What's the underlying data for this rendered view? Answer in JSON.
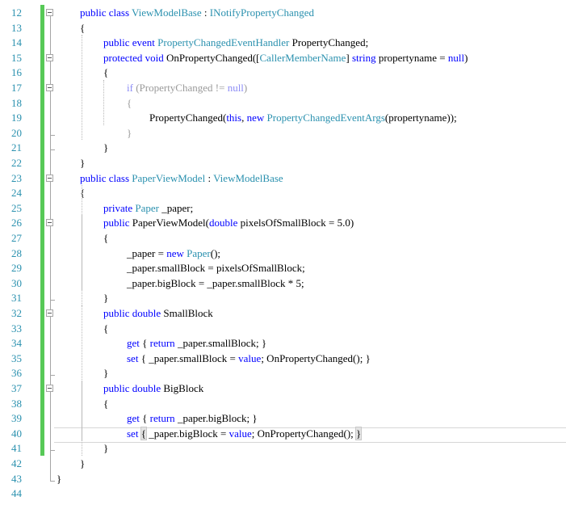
{
  "editor": {
    "language": "C#",
    "colors": {
      "keyword": "#0000ff",
      "type": "#2b91af",
      "line_number": "#2b91af",
      "change_bar": "#57c957",
      "dimmed": "#9a9a9a"
    },
    "lines": [
      {
        "n": "12",
        "tokens": [
          {
            "t": "public class ",
            "c": "kw"
          },
          {
            "t": "ViewModelBase",
            "c": "ty"
          },
          {
            "t": " : "
          },
          {
            "t": "INotifyPropertyChanged",
            "c": "ty"
          }
        ]
      },
      {
        "n": "13",
        "tokens": [
          {
            "t": "{"
          }
        ]
      },
      {
        "n": "14",
        "tokens": [
          {
            "t": "public event ",
            "c": "kw"
          },
          {
            "t": "PropertyChangedEventHandler",
            "c": "ty"
          },
          {
            "t": " PropertyChanged;"
          }
        ]
      },
      {
        "n": "15",
        "tokens": [
          {
            "t": "protected void ",
            "c": "kw"
          },
          {
            "t": "OnPropertyChanged(["
          },
          {
            "t": "CallerMemberName",
            "c": "ty"
          },
          {
            "t": "] "
          },
          {
            "t": "string",
            "c": "kw"
          },
          {
            "t": " propertyname = "
          },
          {
            "t": "null",
            "c": "kw"
          },
          {
            "t": ")"
          }
        ]
      },
      {
        "n": "16",
        "tokens": [
          {
            "t": "{"
          }
        ]
      },
      {
        "n": "17",
        "dim": true,
        "tokens": [
          {
            "t": "if",
            "c": "kw"
          },
          {
            "t": " (PropertyChanged != "
          },
          {
            "t": "null",
            "c": "kw"
          },
          {
            "t": ")"
          }
        ]
      },
      {
        "n": "18",
        "dim": true,
        "tokens": [
          {
            "t": "{"
          }
        ]
      },
      {
        "n": "19",
        "tokens": [
          {
            "t": "PropertyChanged("
          },
          {
            "t": "this",
            "c": "kw"
          },
          {
            "t": ", "
          },
          {
            "t": "new ",
            "c": "kw"
          },
          {
            "t": "PropertyChangedEventArgs",
            "c": "ty"
          },
          {
            "t": "(propertyname));"
          }
        ]
      },
      {
        "n": "20",
        "dim": true,
        "tokens": [
          {
            "t": "}"
          }
        ]
      },
      {
        "n": "21",
        "tokens": [
          {
            "t": "}"
          }
        ]
      },
      {
        "n": "22",
        "tokens": [
          {
            "t": "}"
          }
        ]
      },
      {
        "n": "23",
        "tokens": [
          {
            "t": "public class ",
            "c": "kw"
          },
          {
            "t": "PaperViewModel",
            "c": "ty"
          },
          {
            "t": " : "
          },
          {
            "t": "ViewModelBase",
            "c": "ty"
          }
        ]
      },
      {
        "n": "24",
        "tokens": [
          {
            "t": "{"
          }
        ]
      },
      {
        "n": "25",
        "tokens": [
          {
            "t": "private ",
            "c": "kw"
          },
          {
            "t": "Paper",
            "c": "ty"
          },
          {
            "t": " _paper;"
          }
        ]
      },
      {
        "n": "26",
        "tokens": [
          {
            "t": "public ",
            "c": "kw"
          },
          {
            "t": "PaperViewModel("
          },
          {
            "t": "double",
            "c": "kw"
          },
          {
            "t": " pixelsOfSmallBlock = 5.0)"
          }
        ]
      },
      {
        "n": "27",
        "tokens": [
          {
            "t": "{"
          }
        ]
      },
      {
        "n": "28",
        "tokens": [
          {
            "t": "_paper = "
          },
          {
            "t": "new ",
            "c": "kw"
          },
          {
            "t": "Paper",
            "c": "ty"
          },
          {
            "t": "();"
          }
        ]
      },
      {
        "n": "29",
        "tokens": [
          {
            "t": "_paper.smallBlock = pixelsOfSmallBlock;"
          }
        ]
      },
      {
        "n": "30",
        "tokens": [
          {
            "t": "_paper.bigBlock = _paper.smallBlock * 5;"
          }
        ]
      },
      {
        "n": "31",
        "tokens": [
          {
            "t": "}"
          }
        ]
      },
      {
        "n": "32",
        "tokens": [
          {
            "t": "public double ",
            "c": "kw"
          },
          {
            "t": "SmallBlock"
          }
        ]
      },
      {
        "n": "33",
        "tokens": [
          {
            "t": "{"
          }
        ]
      },
      {
        "n": "34",
        "tokens": [
          {
            "t": "get",
            "c": "kw"
          },
          {
            "t": " { "
          },
          {
            "t": "return",
            "c": "kw"
          },
          {
            "t": " _paper.smallBlock; }"
          }
        ]
      },
      {
        "n": "35",
        "tokens": [
          {
            "t": "set",
            "c": "kw"
          },
          {
            "t": " { _paper.smallBlock = "
          },
          {
            "t": "value",
            "c": "kw"
          },
          {
            "t": "; OnPropertyChanged(); }"
          }
        ]
      },
      {
        "n": "36",
        "tokens": [
          {
            "t": "}"
          }
        ]
      },
      {
        "n": "37",
        "tokens": [
          {
            "t": "public double ",
            "c": "kw"
          },
          {
            "t": "BigBlock"
          }
        ]
      },
      {
        "n": "38",
        "tokens": [
          {
            "t": "{"
          }
        ]
      },
      {
        "n": "39",
        "tokens": [
          {
            "t": "get",
            "c": "kw"
          },
          {
            "t": " { "
          },
          {
            "t": "return",
            "c": "kw"
          },
          {
            "t": " _paper.bigBlock; }"
          }
        ]
      },
      {
        "n": "40",
        "tokens": [
          {
            "t": "set",
            "c": "kw"
          },
          {
            "t": " ",
            "c": "kw"
          },
          {
            "t": "{",
            "hl": true
          },
          {
            "t": " _paper.bigBlock = "
          },
          {
            "t": "value",
            "c": "kw"
          },
          {
            "t": "; OnPropertyChanged(); "
          },
          {
            "t": "}",
            "hl": true,
            "caret": true
          }
        ]
      },
      {
        "n": "41",
        "tokens": [
          {
            "t": "}"
          }
        ]
      },
      {
        "n": "42",
        "tokens": [
          {
            "t": "}"
          }
        ]
      },
      {
        "n": "43",
        "tokens": [
          {
            "t": "}"
          }
        ]
      },
      {
        "n": "44",
        "tokens": []
      }
    ]
  }
}
